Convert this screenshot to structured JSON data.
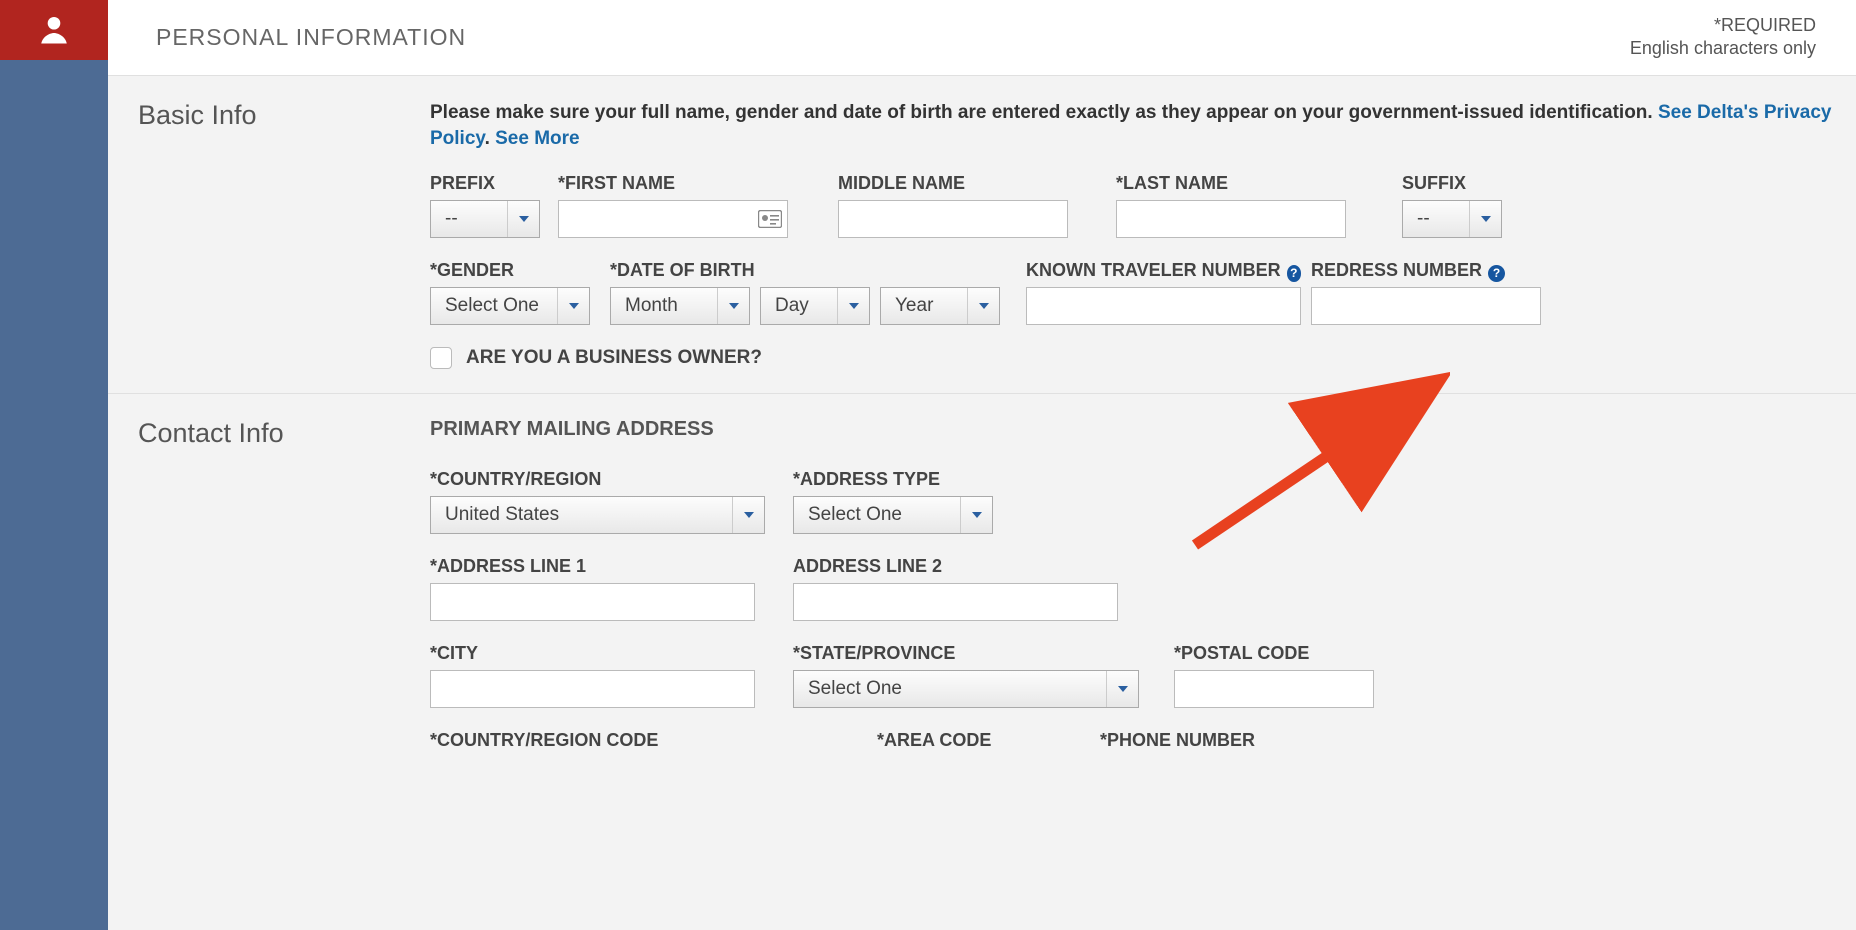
{
  "header": {
    "title": "PERSONAL INFORMATION",
    "required": "*REQUIRED",
    "charset_note": "English characters only"
  },
  "basic": {
    "section_label": "Basic Info",
    "instruction_pre": "Please make sure your full name, gender and date of birth are entered exactly as they appear on your government-issued identification. ",
    "privacy_link": "See Delta's Privacy Policy",
    "period": ". ",
    "see_more": "See More",
    "labels": {
      "prefix": "PREFIX",
      "first": "*FIRST NAME",
      "middle": "MIDDLE NAME",
      "last": "*LAST NAME",
      "suffix": "SUFFIX",
      "gender": "*GENDER",
      "dob": "*DATE OF BIRTH",
      "ktn": "KNOWN TRAVELER NUMBER",
      "redress": "REDRESS NUMBER",
      "biz_owner": "ARE YOU A BUSINESS OWNER?"
    },
    "values": {
      "prefix": "--",
      "suffix": "--",
      "gender": "Select One",
      "month": "Month",
      "day": "Day",
      "year": "Year"
    }
  },
  "contact": {
    "section_label": "Contact Info",
    "subheading": "PRIMARY MAILING ADDRESS",
    "labels": {
      "country": "*COUNTRY/REGION",
      "addr_type": "*ADDRESS TYPE",
      "line1": "*ADDRESS LINE 1",
      "line2": "ADDRESS LINE 2",
      "city": "*CITY",
      "state": "*STATE/PROVINCE",
      "postal": "*POSTAL CODE",
      "cr_code": "*COUNTRY/REGION CODE",
      "area": "*AREA CODE",
      "phone": "*PHONE NUMBER"
    },
    "values": {
      "country": "United States",
      "addr_type": "Select One",
      "state": "Select One"
    }
  },
  "help_glyph": "?"
}
